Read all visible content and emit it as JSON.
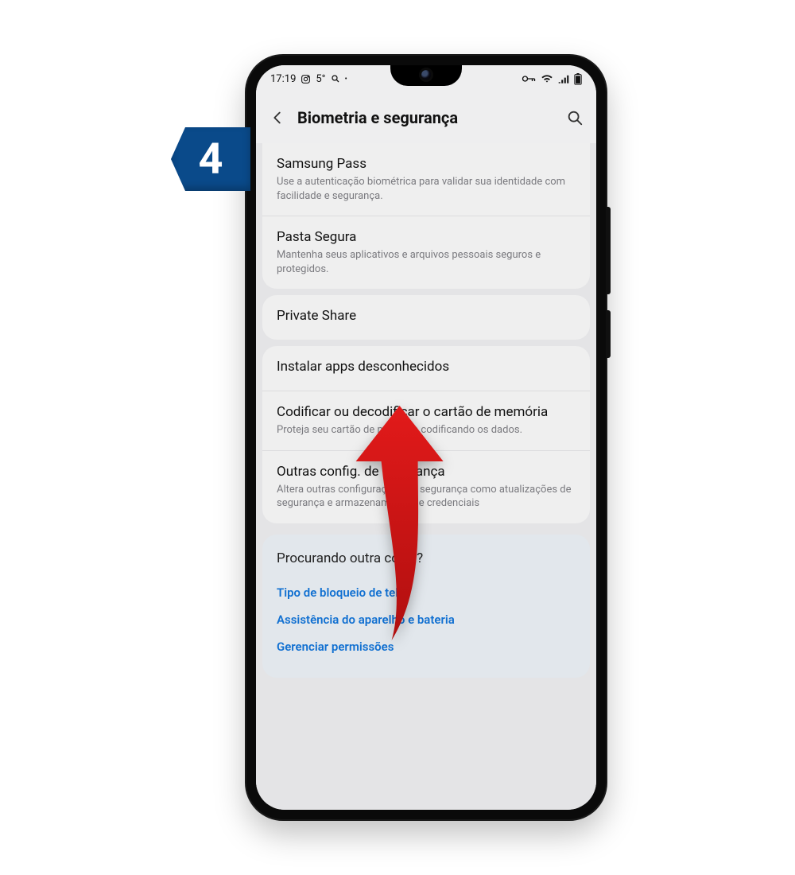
{
  "step": "4",
  "status": {
    "time": "17:19",
    "temp": "5°"
  },
  "header": {
    "title": "Biometria e segurança"
  },
  "groups": [
    {
      "items": [
        {
          "title": "Samsung Pass",
          "sub": "Use a autenticação biométrica para validar sua identidade com facilidade e segurança."
        },
        {
          "title": "Pasta Segura",
          "sub": "Mantenha seus aplicativos e arquivos pessoais seguros e protegidos."
        }
      ]
    },
    {
      "items": [
        {
          "title": "Private Share",
          "sub": ""
        }
      ]
    },
    {
      "items": [
        {
          "title": "Instalar apps desconhecidos",
          "sub": ""
        },
        {
          "title": "Codificar ou decodificar o cartão de memória",
          "sub": "Proteja seu cartão de memória codificando os dados."
        },
        {
          "title": "Outras config. de segurança",
          "sub": "Altera outras configurações de segurança como atualizações de segurança e armazenamento de credenciais"
        }
      ]
    }
  ],
  "looking_for": {
    "heading": "Procurando outra coisa?",
    "links": [
      "Tipo de bloqueio de tela",
      "Assistência do aparelho e bateria",
      "Gerenciar permissões"
    ]
  }
}
